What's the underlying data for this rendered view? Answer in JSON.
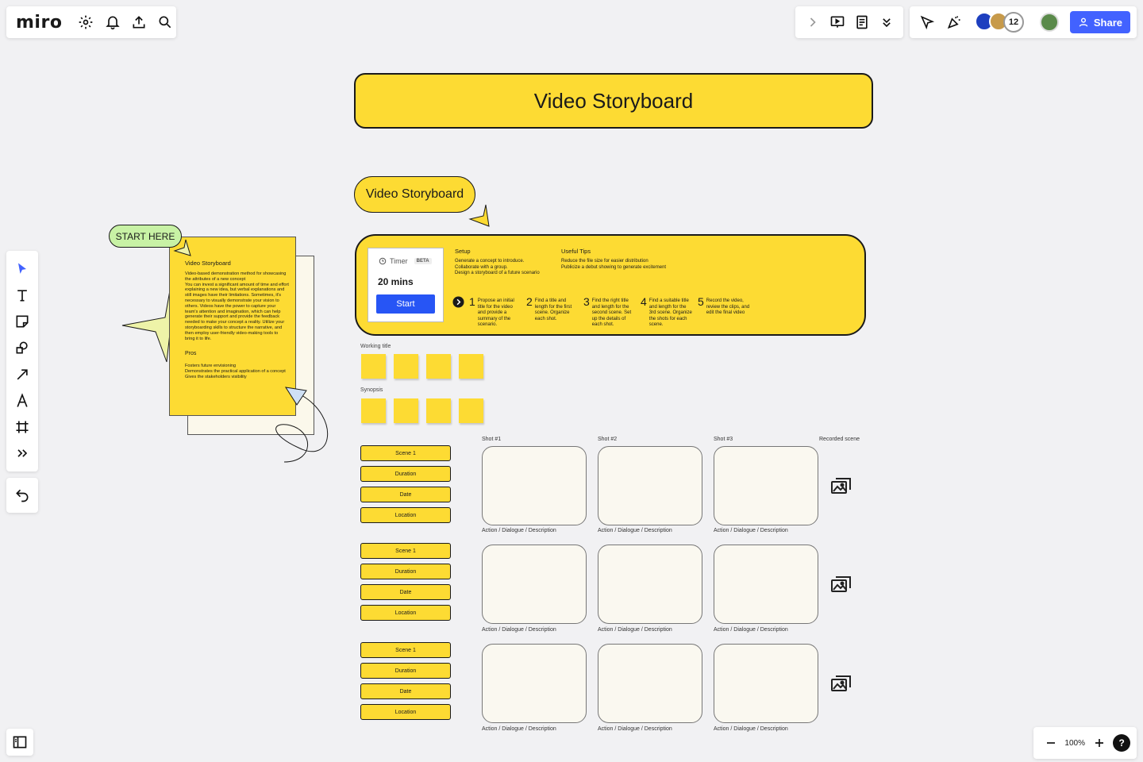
{
  "app": {
    "logo": "miro",
    "share_label": "Share",
    "collaborator_count": "12",
    "zoom_level": "100%",
    "help_label": "?"
  },
  "board": {
    "main_title": "Video Storyboard",
    "pill_title": "Video Storyboard",
    "start_here": "START HERE",
    "timer": {
      "label": "Timer",
      "badge": "BETA",
      "value": "20 mins",
      "start_label": "Start"
    },
    "setup": {
      "heading": "Setup",
      "lines": [
        "Generate a concept to introduce.",
        "Collaborate with a group.",
        "Design a storyboard of a future scenario"
      ]
    },
    "tips": {
      "heading": "Useful Tips",
      "lines": [
        "Reduce the file size for easier distribution",
        "Publicize a debut showing to generate excitement"
      ]
    },
    "steps": [
      {
        "num": "1",
        "text": "Propose an initial title for the video and provide a summary of the scenario."
      },
      {
        "num": "2",
        "text": "Find a title and length for the first scene. Organize each shot."
      },
      {
        "num": "3",
        "text": "Find the right title and length for the second scene. Set up the details of each shot."
      },
      {
        "num": "4",
        "text": "Find a suitable title and length for the 3rd scene. Organize the shots for each scene."
      },
      {
        "num": "5",
        "text": "Record the video, review the clips, and edit the final video"
      }
    ],
    "working_title_label": "Working title",
    "synopsis_label": "Synopsis",
    "shot_headers": [
      "Shot #1",
      "Shot #2",
      "Shot #3",
      "Recorded scene"
    ],
    "caption": "Action / Dialogue / Description",
    "scene_rows": [
      {
        "labels": [
          "Scene 1",
          "Duration",
          "Date",
          "Location"
        ]
      },
      {
        "labels": [
          "Scene 1",
          "Duration",
          "Date",
          "Location"
        ]
      },
      {
        "labels": [
          "Scene 1",
          "Duration",
          "Date",
          "Location"
        ]
      }
    ],
    "doc": {
      "title": "Video Storyboard",
      "body": "Video-based demonstration method for showcasing the attributes of a new concept\nYou can invest a significant amount of time and effort explaining a new idea, but verbal explanations and still images have their limitations. Sometimes, it's necessary to visually demonstrate your vision to others. Videos have the power to capture your team's attention and imagination, which can help generate their support and provide the feedback needed to make your concept a reality. Utilize your storyboarding skills to structure the narrative, and then employ user-friendly video-making tools to bring it to life.",
      "pros_heading": "Pros",
      "pros": [
        "Fosters future envisioning",
        "Demonstrates the practical application of a concept",
        "Gives the stakeholders visibility"
      ]
    }
  },
  "colors": {
    "accent_yellow": "#fddb33",
    "primary_blue": "#4262ff",
    "start_green": "#c8f2a5",
    "canvas": "#f1f1f3"
  }
}
